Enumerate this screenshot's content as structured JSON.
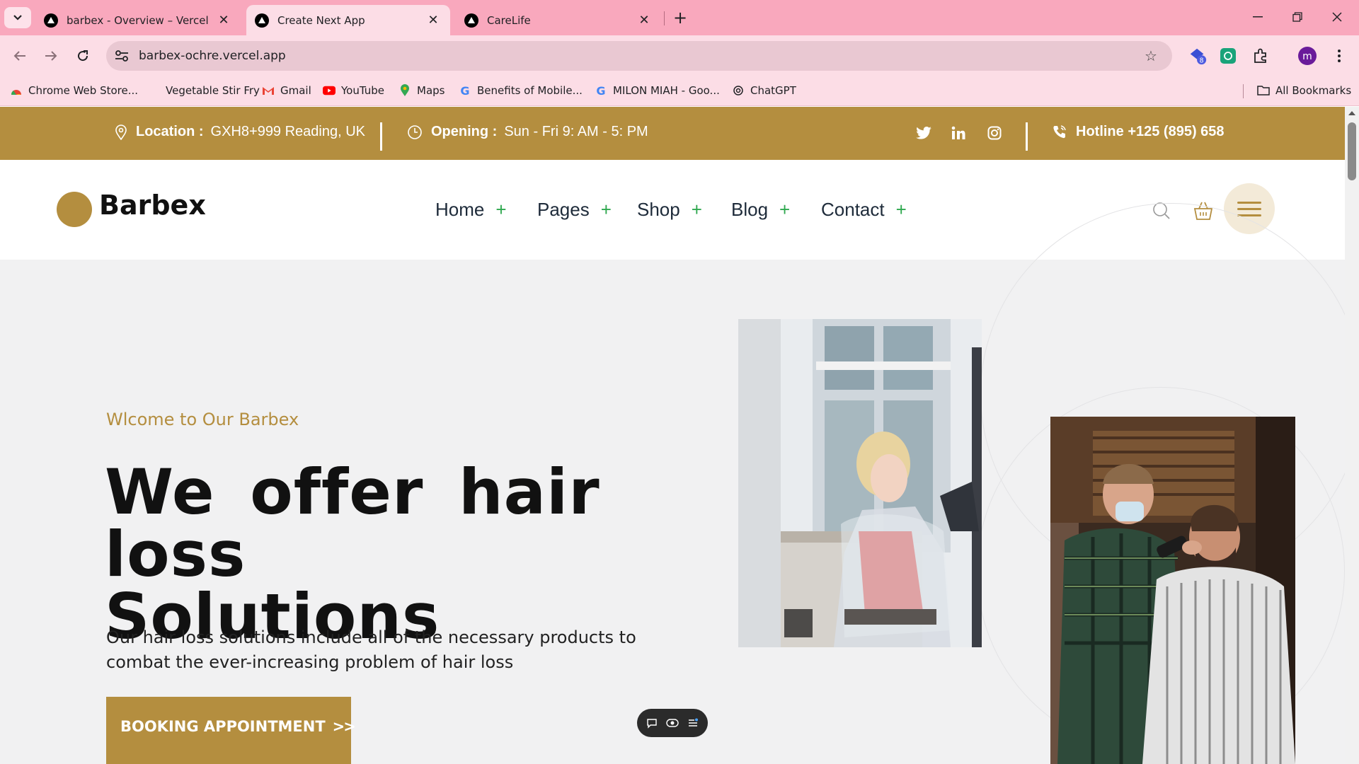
{
  "browser": {
    "tabs": [
      {
        "title": "barbex - Overview – Vercel",
        "active": false
      },
      {
        "title": "Create Next App",
        "active": true
      },
      {
        "title": "CareLife",
        "active": false
      }
    ],
    "url": "barbex-ochre.vercel.app",
    "extension_badge": "8",
    "profile_initial": "m",
    "bookmarks": [
      {
        "label": "Chrome Web Store...",
        "icon": "chrome-store-icon"
      },
      {
        "label": "Vegetable Stir Fry",
        "icon": "none"
      },
      {
        "label": "Gmail",
        "icon": "gmail-icon"
      },
      {
        "label": "YouTube",
        "icon": "youtube-icon"
      },
      {
        "label": "Maps",
        "icon": "maps-icon"
      },
      {
        "label": "Benefits of Mobile...",
        "icon": "google-icon"
      },
      {
        "label": "MILON MIAH - Goo...",
        "icon": "google-icon"
      },
      {
        "label": "ChatGPT",
        "icon": "chatgpt-icon"
      }
    ],
    "all_bookmarks": "All Bookmarks"
  },
  "topbar": {
    "location_label": "Location :",
    "location_value": "GXH8+999 Reading, UK",
    "opening_label": "Opening :",
    "opening_value": "Sun - Fri 9: AM - 5: PM",
    "hotline": "Hotline +125 (895) 658",
    "social": [
      "twitter-icon",
      "linkedin-icon",
      "instagram-icon"
    ]
  },
  "header": {
    "logo": "Barbex",
    "menu": [
      {
        "label": "Home"
      },
      {
        "label": "Pages"
      },
      {
        "label": "Shop"
      },
      {
        "label": "Blog"
      },
      {
        "label": "Contact"
      }
    ]
  },
  "hero": {
    "welcome": "Wlcome to Our Barbex",
    "headline_line1": "We offer hair loss",
    "headline_line2": "Solutions",
    "description": "Our hair loss solutions include all of the necessary products to combat the ever-increasing problem of hair loss",
    "cta": "BOOKING APPOINTMENT",
    "cta_arrows": ">>"
  },
  "colors": {
    "brand": "#b48e3f",
    "tabbar": "#f9a8bd",
    "plus": "#2fa84f"
  }
}
